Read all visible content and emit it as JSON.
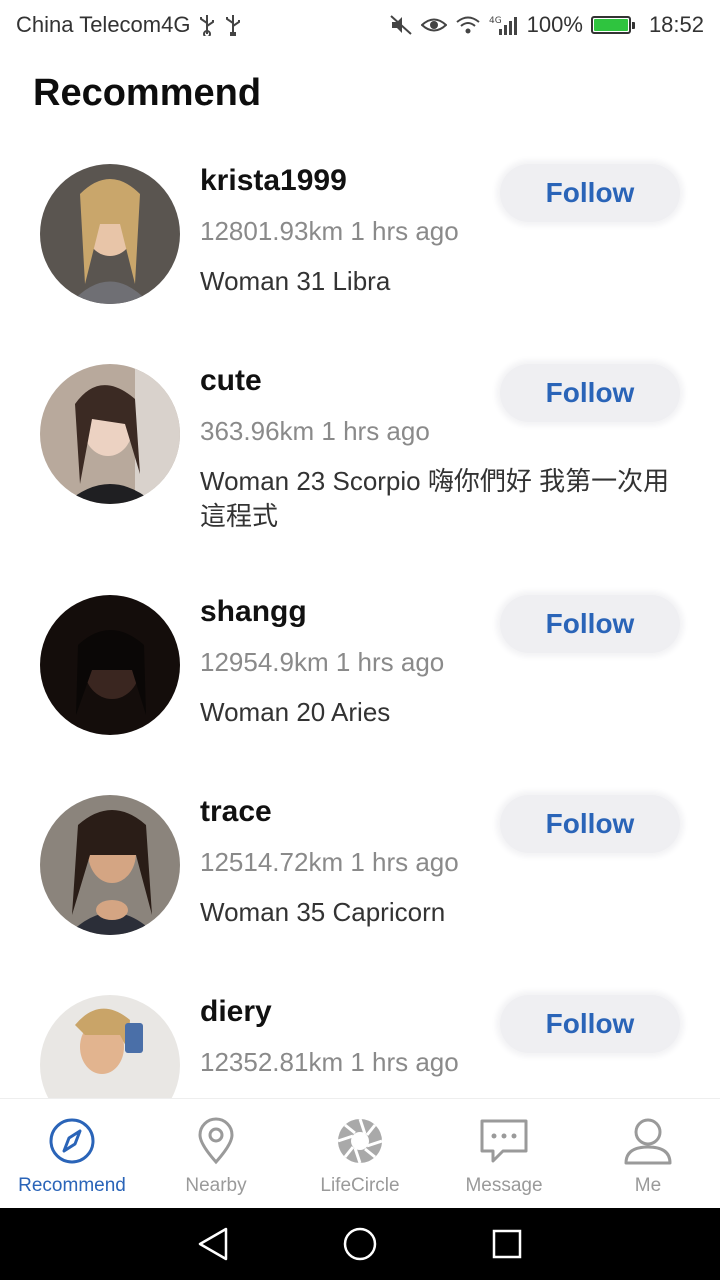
{
  "status_bar": {
    "carrier": "China Telecom4G",
    "signal_label": "4G",
    "battery": "100%",
    "time": "18:52"
  },
  "header": {
    "title": "Recommend"
  },
  "users": [
    {
      "username": "krista1999",
      "meta": "12801.93km 1 hrs ago",
      "bio": "Woman 31 Libra",
      "follow_label": "Follow"
    },
    {
      "username": "cute",
      "meta": "363.96km 1 hrs ago",
      "bio": "Woman 23 Scorpio 嗨你們好 我第一次用這程式",
      "follow_label": "Follow"
    },
    {
      "username": "shangg",
      "meta": "12954.9km 1 hrs ago",
      "bio": "Woman 20 Aries",
      "follow_label": "Follow"
    },
    {
      "username": "trace",
      "meta": "12514.72km 1 hrs ago",
      "bio": "Woman 35 Capricorn",
      "follow_label": "Follow"
    },
    {
      "username": "diery",
      "meta": "12352.81km 1 hrs ago",
      "bio": "",
      "follow_label": "Follow"
    }
  ],
  "tabs": [
    {
      "label": "Recommend",
      "icon": "compass-icon",
      "active": true
    },
    {
      "label": "Nearby",
      "icon": "location-pin-icon",
      "active": false
    },
    {
      "label": "LifeCircle",
      "icon": "aperture-icon",
      "active": false
    },
    {
      "label": "Message",
      "icon": "chat-bubble-icon",
      "active": false
    },
    {
      "label": "Me",
      "icon": "person-icon",
      "active": false
    }
  ],
  "colors": {
    "accent": "#2a64b8",
    "inactive": "#9a9a9a",
    "button_bg": "#efeff2",
    "battery_fill": "#2fc43f"
  }
}
